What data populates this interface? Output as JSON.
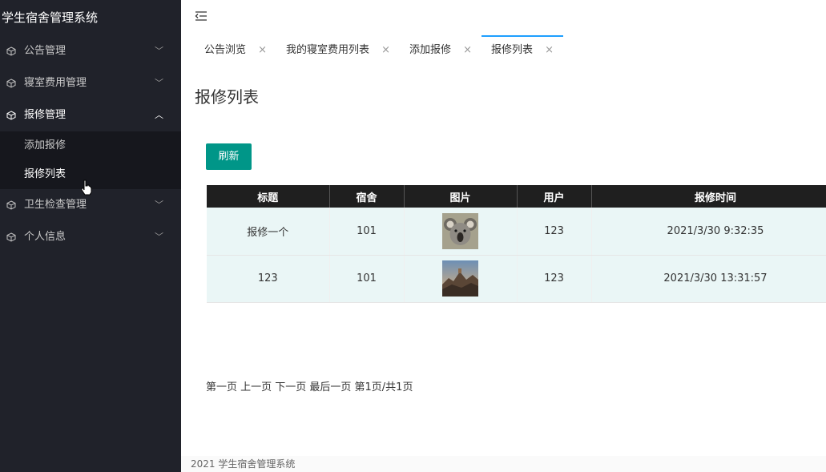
{
  "app": {
    "title": "学生宿舍管理系统"
  },
  "sidebar": {
    "items": [
      {
        "label": "公告管理",
        "icon": "cube-icon",
        "open": false
      },
      {
        "label": "寝室费用管理",
        "icon": "cube-icon",
        "open": false
      },
      {
        "label": "报修管理",
        "icon": "cube-icon",
        "open": true,
        "children": [
          {
            "label": "添加报修",
            "active": false
          },
          {
            "label": "报修列表",
            "active": true
          }
        ]
      },
      {
        "label": "卫生检查管理",
        "icon": "cube-icon",
        "open": false
      },
      {
        "label": "个人信息",
        "icon": "cube-icon",
        "open": false
      }
    ]
  },
  "tabs": [
    {
      "label": "公告浏览",
      "active": false
    },
    {
      "label": "我的寝室费用列表",
      "active": false
    },
    {
      "label": "添加报修",
      "active": false
    },
    {
      "label": "报修列表",
      "active": true
    }
  ],
  "main": {
    "title": "报修列表",
    "refresh_label": "刷新",
    "table": {
      "columns": [
        "标题",
        "宿舍",
        "图片",
        "用户",
        "报修时间"
      ],
      "rows": [
        {
          "title": "报修一个",
          "dorm": "101",
          "image": "koala-photo",
          "user": "123",
          "time": "2021/3/30 9:32:35"
        },
        {
          "title": "123",
          "dorm": "101",
          "image": "mountain-photo",
          "user": "123",
          "time": "2021/3/30 13:31:57"
        }
      ]
    },
    "pager": "第一页 上一页 下一页 最后一页 第1页/共1页"
  },
  "footer": "2021 学生宿舍管理系统",
  "colors": {
    "sidebar_bg": "#20222a",
    "accent": "#009688",
    "tab_active": "#1e9fff",
    "table_header": "#1f1f1f"
  }
}
